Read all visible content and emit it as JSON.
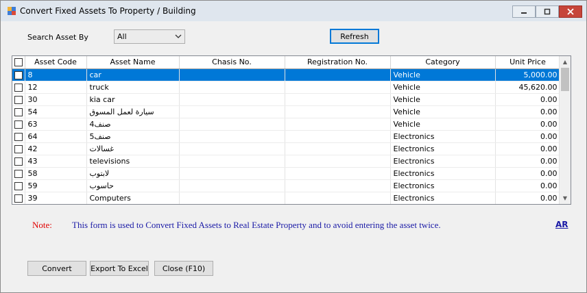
{
  "window": {
    "title": "Convert Fixed Assets To Property / Building",
    "controls": {
      "minimize": "minimize-icon",
      "maximize": "maximize-icon",
      "close": "close-icon"
    }
  },
  "search": {
    "label": "Search Asset By",
    "selected": "All",
    "refresh_label": "Refresh"
  },
  "grid": {
    "columns": [
      "Asset Code",
      "Asset Name",
      "Chasis No.",
      "Registration No.",
      "Category",
      "Unit Price"
    ],
    "rows": [
      {
        "code": "8",
        "name": "car",
        "chasis": "",
        "registration": "",
        "category": "Vehicle",
        "price": "5,000.00",
        "selected": true
      },
      {
        "code": "12",
        "name": "truck",
        "chasis": "",
        "registration": "",
        "category": "Vehicle",
        "price": "45,620.00"
      },
      {
        "code": "30",
        "name": "kia car",
        "chasis": "",
        "registration": "",
        "category": "Vehicle",
        "price": "0.00"
      },
      {
        "code": "54",
        "name": "سيارة لعمل المسوق",
        "chasis": "",
        "registration": "",
        "category": "Vehicle",
        "price": "0.00"
      },
      {
        "code": "63",
        "name": "صنف4",
        "chasis": "",
        "registration": "",
        "category": "Vehicle",
        "price": "0.00"
      },
      {
        "code": "64",
        "name": "صنف5",
        "chasis": "",
        "registration": "",
        "category": "Electronics",
        "price": "0.00"
      },
      {
        "code": "42",
        "name": "غسالات",
        "chasis": "",
        "registration": "",
        "category": "Electronics",
        "price": "0.00"
      },
      {
        "code": "43",
        "name": "televisions",
        "chasis": "",
        "registration": "",
        "category": "Electronics",
        "price": "0.00"
      },
      {
        "code": "58",
        "name": "لابتوب",
        "chasis": "",
        "registration": "",
        "category": "Electronics",
        "price": "0.00"
      },
      {
        "code": "59",
        "name": "حاسوب",
        "chasis": "",
        "registration": "",
        "category": "Electronics",
        "price": "0.00"
      },
      {
        "code": "39",
        "name": "Computers",
        "chasis": "",
        "registration": "",
        "category": "Electronics",
        "price": "0.00"
      }
    ]
  },
  "note": {
    "label": "Note:",
    "text": "This form is used to Convert Fixed Assets to Real Estate Property and to avoid entering the asset twice.",
    "link": "AR"
  },
  "buttons": {
    "convert": "Convert",
    "export": "Export To Excel",
    "close": "Close (F10)"
  },
  "colors": {
    "selection": "#0078d7",
    "note_label": "#e00000",
    "note_text": "#1a1aa6"
  }
}
